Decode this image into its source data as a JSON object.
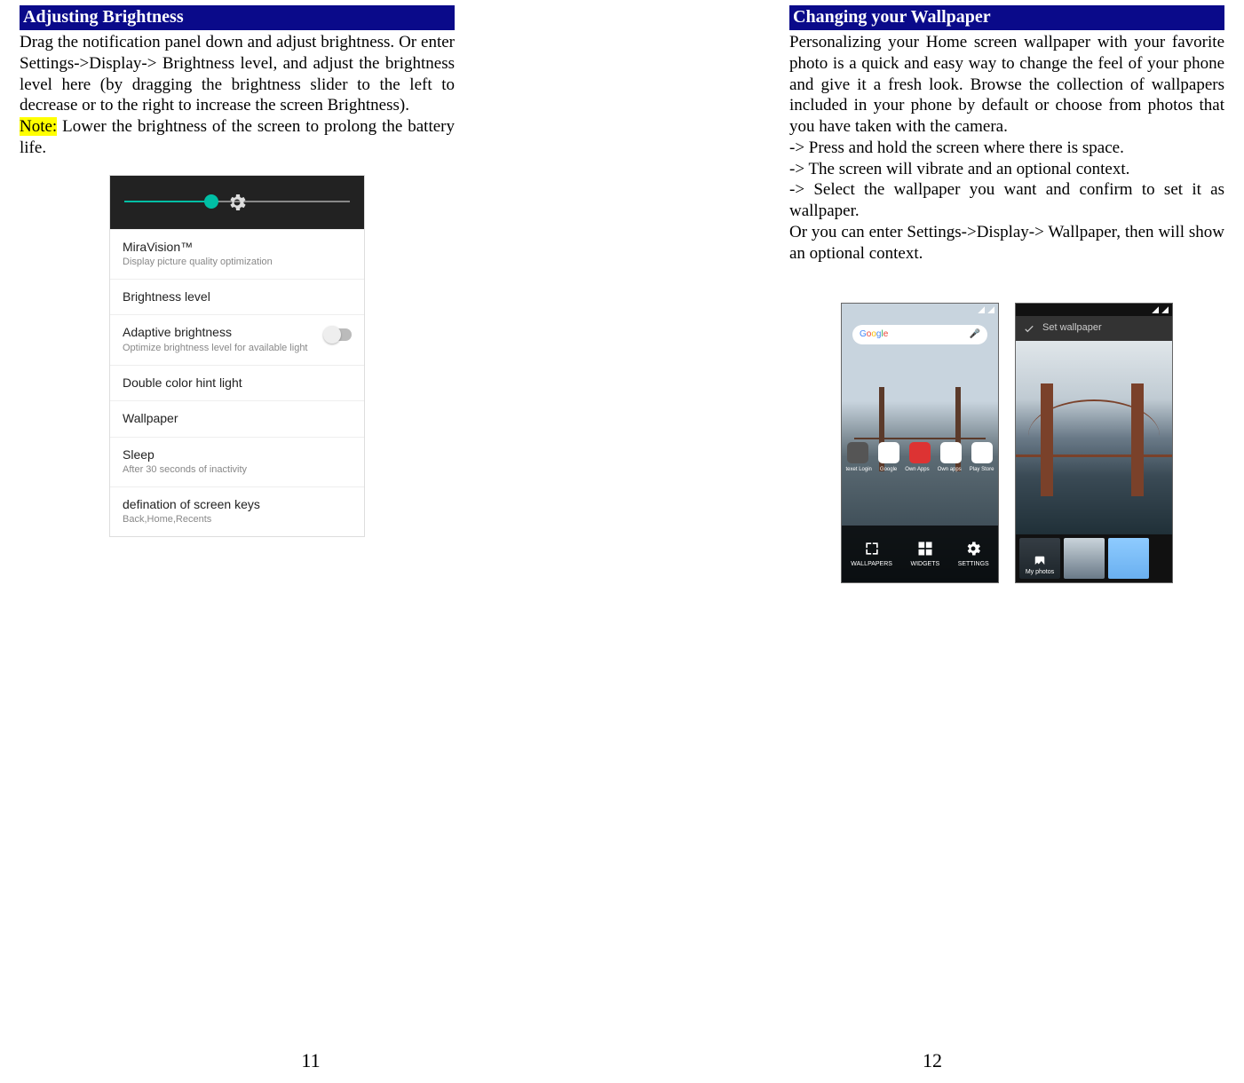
{
  "left": {
    "header": "Adjusting Brightness",
    "para1": "Drag the notification panel down and adjust brightness. Or enter Settings->Display-> Brightness level, and adjust the brightness level here (by dragging the brightness slider to the left to decrease or to the right to increase the screen Brightness).",
    "noteLabel": "Note:",
    "noteText": " Lower the brightness of the screen to prolong the battery life.",
    "pageNumber": "11",
    "displaySettings": {
      "rows": [
        {
          "title": "MiraVision™",
          "sub": "Display picture quality optimization"
        },
        {
          "title": "Brightness level",
          "sub": ""
        },
        {
          "title": "Adaptive brightness",
          "sub": "Optimize brightness level for available light",
          "toggle": true
        },
        {
          "title": "Double color hint light",
          "sub": ""
        },
        {
          "title": "Wallpaper",
          "sub": ""
        },
        {
          "title": "Sleep",
          "sub": "After 30 seconds of inactivity"
        },
        {
          "title": "defination of screen keys",
          "sub": "Back,Home,Recents"
        }
      ]
    }
  },
  "right": {
    "header": "Changing your Wallpaper",
    "para1": "Personalizing your Home screen wallpaper with your favorite photo is a quick and easy way to change the feel of your phone and give it a fresh look. Browse the collection of wallpapers included in your phone by default or choose from photos that you have taken with the camera.",
    "step1": "-> Press and hold the screen where there is space.",
    "step2": "-> The screen will vibrate and an optional context.",
    "step3": "-> Select the wallpaper you want and confirm to set it as wallpaper.",
    "para2": "Or you can enter Settings->Display-> Wallpaper, then will show an optional context.",
    "pageNumber": "12",
    "homeScreen": {
      "searchLabel": "Google",
      "appLabels": [
        "texet Login",
        "Google",
        "Own Apps",
        "Own apps",
        "Play Store"
      ],
      "bottomButtons": [
        "WALLPAPERS",
        "WIDGETS",
        "SETTINGS"
      ]
    },
    "setWallpaper": {
      "title": "Set wallpaper",
      "myPhotos": "My photos"
    }
  }
}
